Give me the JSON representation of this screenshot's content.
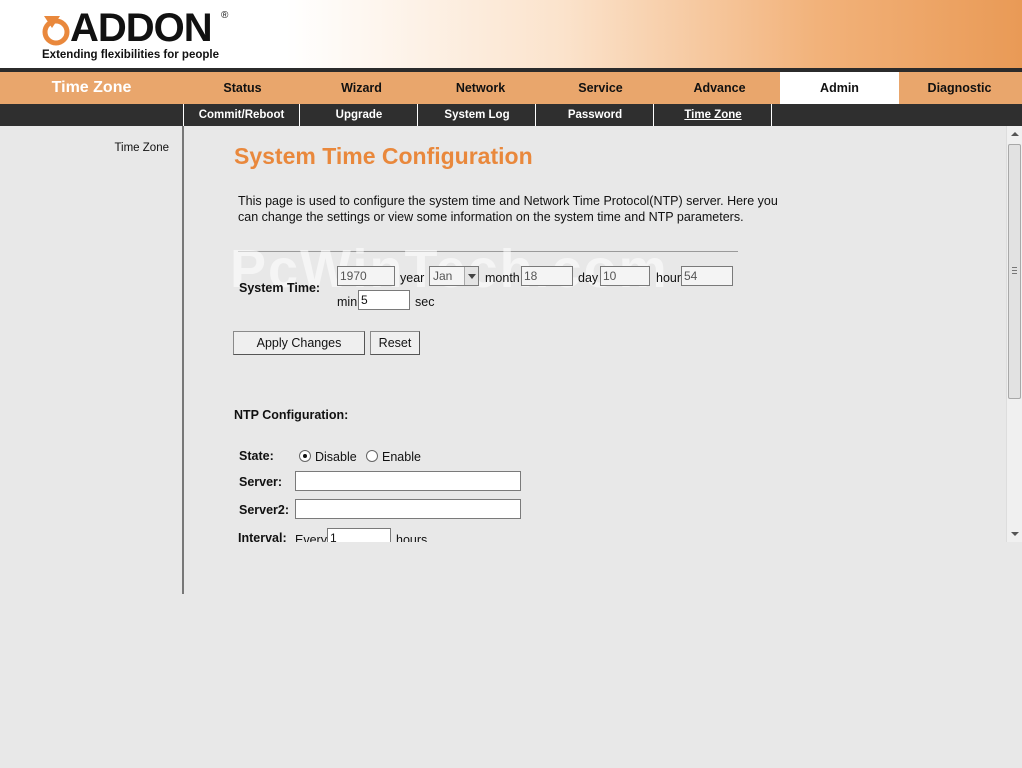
{
  "brand": {
    "name": "ADDON",
    "registered": "®",
    "tagline": "Extending flexibilities for people",
    "logo_color": "#e9883c"
  },
  "section_title": "Time Zone",
  "main_nav": [
    {
      "label": "Status",
      "active": false
    },
    {
      "label": "Wizard",
      "active": false
    },
    {
      "label": "Network",
      "active": false
    },
    {
      "label": "Service",
      "active": false
    },
    {
      "label": "Advance",
      "active": false
    },
    {
      "label": "Admin",
      "active": true
    },
    {
      "label": "Diagnostic",
      "active": false
    }
  ],
  "sub_nav": [
    {
      "label": "Commit/Reboot",
      "active": false
    },
    {
      "label": "Upgrade",
      "active": false
    },
    {
      "label": "System Log",
      "active": false
    },
    {
      "label": "Password",
      "active": false
    },
    {
      "label": "Time Zone",
      "active": true
    }
  ],
  "left_nav": {
    "items": [
      "Time Zone"
    ]
  },
  "watermark": "PcWinTech.com",
  "page": {
    "title": "System Time Configuration",
    "description": "This page is used to configure the system time and Network Time Protocol(NTP) server. Here you can change the settings or view some information on the system time and NTP parameters.",
    "system_time": {
      "label": "System Time:",
      "year": {
        "value": "1970",
        "unit": "year"
      },
      "month": {
        "value": "Jan",
        "unit": "month"
      },
      "day": {
        "value": "18",
        "unit": "day"
      },
      "hour": {
        "value": "10",
        "unit": "hour"
      },
      "minute": {
        "value": "54",
        "unit": "min"
      },
      "second": {
        "value": "5",
        "unit": "sec"
      }
    },
    "buttons": {
      "apply": "Apply Changes",
      "reset": "Reset"
    },
    "ntp": {
      "heading": "NTP Configuration:",
      "state_label": "State:",
      "state_options": [
        "Disable",
        "Enable"
      ],
      "state_selected": "Disable",
      "server_label": "Server:",
      "server_value": "",
      "server2_label": "Server2:",
      "server2_value": "",
      "interval_label": "Interval:",
      "interval_prefix": "Every",
      "interval_value": "1",
      "interval_unit": "hours"
    }
  },
  "colors": {
    "nav_bg": "#e9a66c",
    "subnav_bg": "#2f2f2f",
    "title_orange": "#e9883c",
    "page_bg": "#e8e8e8"
  }
}
